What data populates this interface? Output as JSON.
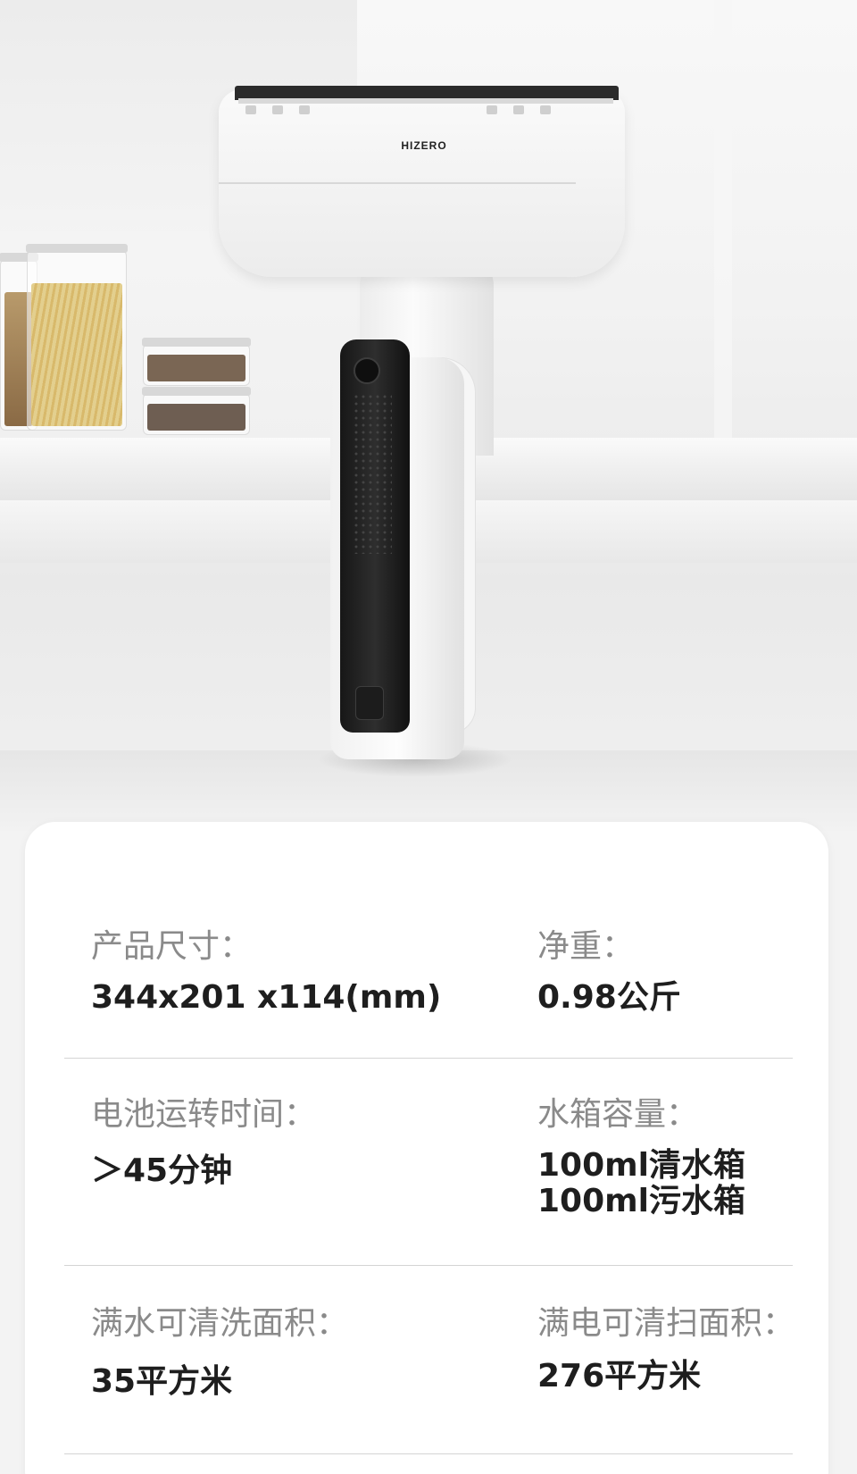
{
  "product": {
    "brand": "HIZERO"
  },
  "specs": {
    "size": {
      "label": "产品尺寸：",
      "value": "344x201 x114(mm)"
    },
    "weight": {
      "label": "净重：",
      "value": "0.98公斤"
    },
    "battery": {
      "label": "电池运转时间：",
      "value": "＞45分钟"
    },
    "tank": {
      "label": "水箱容量：",
      "value_line1": "100ml清水箱",
      "value_line2": "100ml污水箱"
    },
    "wash_area": {
      "label": "满水可清洗面积：",
      "value": "35平方米"
    },
    "sweep_area": {
      "label": "满电可清扫面积：",
      "value": "276平方米"
    }
  }
}
